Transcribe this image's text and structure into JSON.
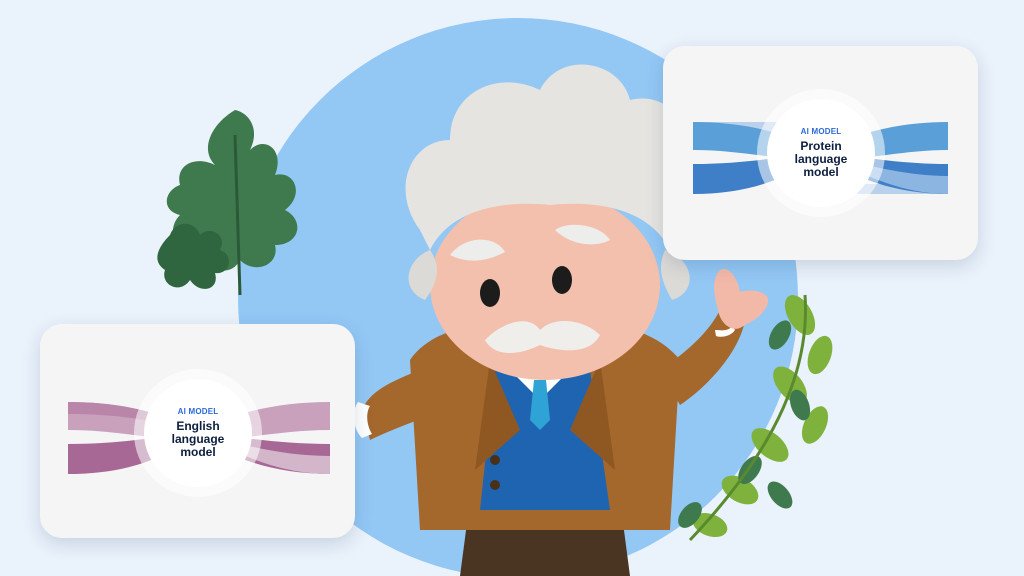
{
  "cards": {
    "protein": {
      "kicker": "AI MODEL",
      "title": "Protein language model",
      "ribbon_colors": [
        "#5a9fd8",
        "#3f7fc8",
        "#8db5e2"
      ]
    },
    "english": {
      "kicker": "AI MODEL",
      "title": "English language model",
      "ribbon_colors": [
        "#b985a8",
        "#a76896",
        "#d4b6cb"
      ]
    }
  },
  "colors": {
    "background": "#eaf2fb",
    "circle": "#93c7f4",
    "card": "#f5f5f6",
    "leaf_dark": "#3f7a4e",
    "leaf_light": "#7fb23d"
  },
  "illustration": {
    "mascot": "einstein-mascot",
    "decorations": [
      "leaf-left",
      "leaf-right"
    ]
  }
}
